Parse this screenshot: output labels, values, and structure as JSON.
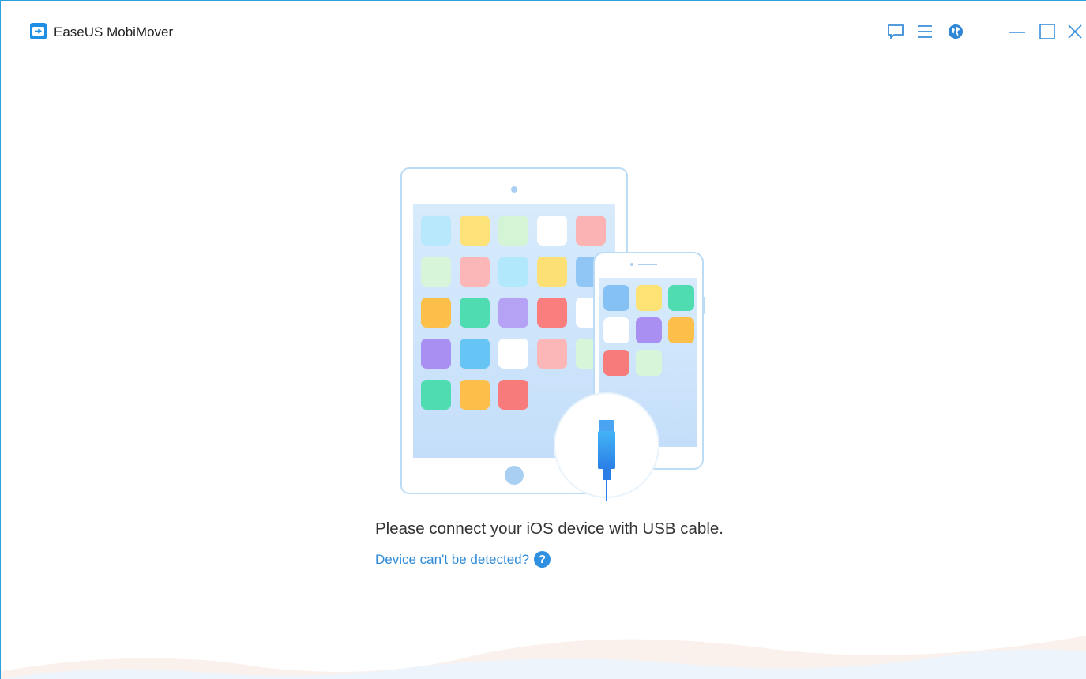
{
  "app": {
    "title": "EaseUS MobiMover"
  },
  "window_controls": {
    "feedback_icon": "feedback-icon",
    "menu_icon": "menu-icon",
    "language_icon": "globe-icon",
    "minimize_icon": "minimize-icon",
    "maximize_icon": "maximize-icon",
    "close_icon": "close-icon"
  },
  "main": {
    "message": "Please connect your iOS device with USB cable.",
    "help_link": "Device can't be detected?",
    "help_icon_glyph": "?"
  },
  "colors": {
    "accent": "#2e8ad8",
    "border": "#29a0e0",
    "device_outline": "#bcdcf5",
    "screen": "#cfe5fb"
  }
}
